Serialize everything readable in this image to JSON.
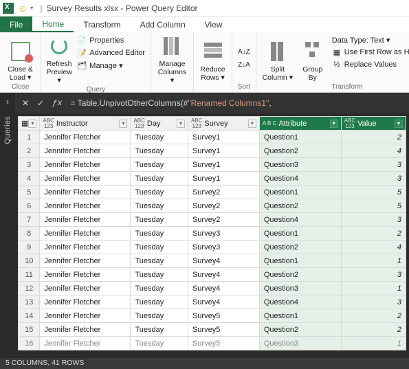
{
  "title": {
    "filename": "Survey Results xlsx",
    "app": "Power Query Editor",
    "sep": "|"
  },
  "tabs": {
    "file": "File",
    "items": [
      "Home",
      "Transform",
      "Add Column",
      "View"
    ],
    "active_index": 0
  },
  "ribbon": {
    "close": {
      "label": "Close &\nLoad ▾",
      "group": "Close"
    },
    "query": {
      "refresh": "Refresh\nPreview ▾",
      "properties": "Properties",
      "advanced": "Advanced Editor",
      "manage": "Manage ▾",
      "group": "Query"
    },
    "cols": {
      "label": "Manage\nColumns ▾"
    },
    "rows": {
      "label": "Reduce\nRows ▾"
    },
    "sort": {
      "group": "Sort"
    },
    "split": "Split\nColumn ▾",
    "groupby": "Group\nBy",
    "datatype": "Data Type: Text ▾",
    "firstrow": "Use First Row as Headers",
    "replace": "Replace Values",
    "transform_group": "Transform"
  },
  "rail": {
    "label": "Queries"
  },
  "formula": {
    "prefix": "= Table.UnpivotOtherColumns(#",
    "string": "\"Renamed Columns1\"",
    "suffix": ","
  },
  "columns": [
    {
      "name": "Instructor",
      "type": "ABC\n123",
      "green": false
    },
    {
      "name": "Day",
      "type": "ABC\n123",
      "green": false
    },
    {
      "name": "Survey",
      "type": "ABC\n123",
      "green": false
    },
    {
      "name": "Attribute",
      "type": "A B C",
      "green": true
    },
    {
      "name": "Value",
      "type": "ABC\n123",
      "green": true
    }
  ],
  "rows": [
    {
      "n": 1,
      "instructor": "Jennifer Fletcher",
      "day": "Tuesday",
      "survey": "Survey1",
      "attribute": "Question1",
      "value": 2
    },
    {
      "n": 2,
      "instructor": "Jennifer Fletcher",
      "day": "Tuesday",
      "survey": "Survey1",
      "attribute": "Question2",
      "value": 4
    },
    {
      "n": 3,
      "instructor": "Jennifer Fletcher",
      "day": "Tuesday",
      "survey": "Survey1",
      "attribute": "Question3",
      "value": 3
    },
    {
      "n": 4,
      "instructor": "Jennifer Fletcher",
      "day": "Tuesday",
      "survey": "Survey1",
      "attribute": "Question4",
      "value": 3
    },
    {
      "n": 5,
      "instructor": "Jennifer Fletcher",
      "day": "Tuesday",
      "survey": "Survey2",
      "attribute": "Question1",
      "value": 5
    },
    {
      "n": 6,
      "instructor": "Jennifer Fletcher",
      "day": "Tuesday",
      "survey": "Survey2",
      "attribute": "Question2",
      "value": 5
    },
    {
      "n": 7,
      "instructor": "Jennifer Fletcher",
      "day": "Tuesday",
      "survey": "Survey2",
      "attribute": "Question4",
      "value": 3
    },
    {
      "n": 8,
      "instructor": "Jennifer Fletcher",
      "day": "Tuesday",
      "survey": "Survey3",
      "attribute": "Question1",
      "value": 2
    },
    {
      "n": 9,
      "instructor": "Jennifer Fletcher",
      "day": "Tuesday",
      "survey": "Survey3",
      "attribute": "Question2",
      "value": 4
    },
    {
      "n": 10,
      "instructor": "Jennifer Fletcher",
      "day": "Tuesday",
      "survey": "Survey4",
      "attribute": "Question1",
      "value": 1
    },
    {
      "n": 11,
      "instructor": "Jennifer Fletcher",
      "day": "Tuesday",
      "survey": "Survey4",
      "attribute": "Question2",
      "value": 3
    },
    {
      "n": 12,
      "instructor": "Jennifer Fletcher",
      "day": "Tuesday",
      "survey": "Survey4",
      "attribute": "Question3",
      "value": 1
    },
    {
      "n": 13,
      "instructor": "Jennifer Fletcher",
      "day": "Tuesday",
      "survey": "Survey4",
      "attribute": "Question4",
      "value": 3
    },
    {
      "n": 14,
      "instructor": "Jennifer Fletcher",
      "day": "Tuesday",
      "survey": "Survey5",
      "attribute": "Question1",
      "value": 2
    },
    {
      "n": 15,
      "instructor": "Jennifer Fletcher",
      "day": "Tuesday",
      "survey": "Survey5",
      "attribute": "Question2",
      "value": 2
    },
    {
      "n": 16,
      "instructor": "Jennifer Fletcher",
      "day": "Tuesday",
      "survey": "Survey5",
      "attribute": "Question3",
      "value": 1
    }
  ],
  "status": "5 COLUMNS, 41 ROWS"
}
